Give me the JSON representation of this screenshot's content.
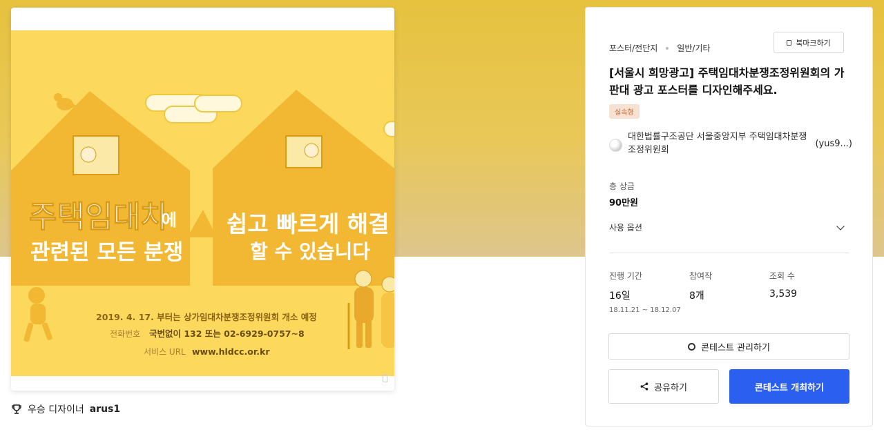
{
  "poster": {
    "headline1_main": "주택임대차",
    "headline1_suffix": "에",
    "headline1_line2": "관련된 모든 분쟁",
    "headline2_line1": "쉽고 빠르게 해결",
    "headline2_line2": "할 수 있습니다",
    "footer_line1": "2019. 4. 17. 부터는 상가임대차분쟁조정위원회 개소 예정",
    "footer_phone_label": "전화번호",
    "footer_phone_value": "국번없이 132 또는 02-6929-0757~8",
    "footer_url_label": "서비스 URL",
    "footer_url_value": "www.hldcc.or.kr"
  },
  "winner": {
    "label": "우승 디자이너",
    "name": "arus1"
  },
  "panel": {
    "category": "포스터/전단지",
    "subcategory": "일반/기타",
    "bookmark_label": "북마크하기",
    "title": "[서울시 희망광고] 주택임대차분쟁조정위원회의 가판대 광고 포스터를 디자인해주세요.",
    "badge": "실속형",
    "host_org": "대한법률구조공단 서울중앙지부 주택임대차분쟁조정위원회",
    "host_user": "(yus9...)",
    "prize_label": "총 상금",
    "prize_value": "90만원",
    "options_label": "사용 옵션",
    "stats": {
      "period_label": "진행 기간",
      "period_value": "16일",
      "period_dates": "18.11.21 ~ 18.12.07",
      "entries_label": "참여작",
      "entries_value": "8개",
      "views_label": "조회 수",
      "views_value": "3,539"
    },
    "manage_label": "콘테스트 관리하기",
    "share_label": "공유하기",
    "host_button_label": "콘테스트 개최하기"
  },
  "colors": {
    "hero_bg": "#e6c23e",
    "poster_bg": "#fcd95c",
    "house": "#f2b733",
    "primary_button": "#2b5ff0",
    "badge_bg": "#f7e1d2",
    "badge_text": "#c96a30"
  }
}
